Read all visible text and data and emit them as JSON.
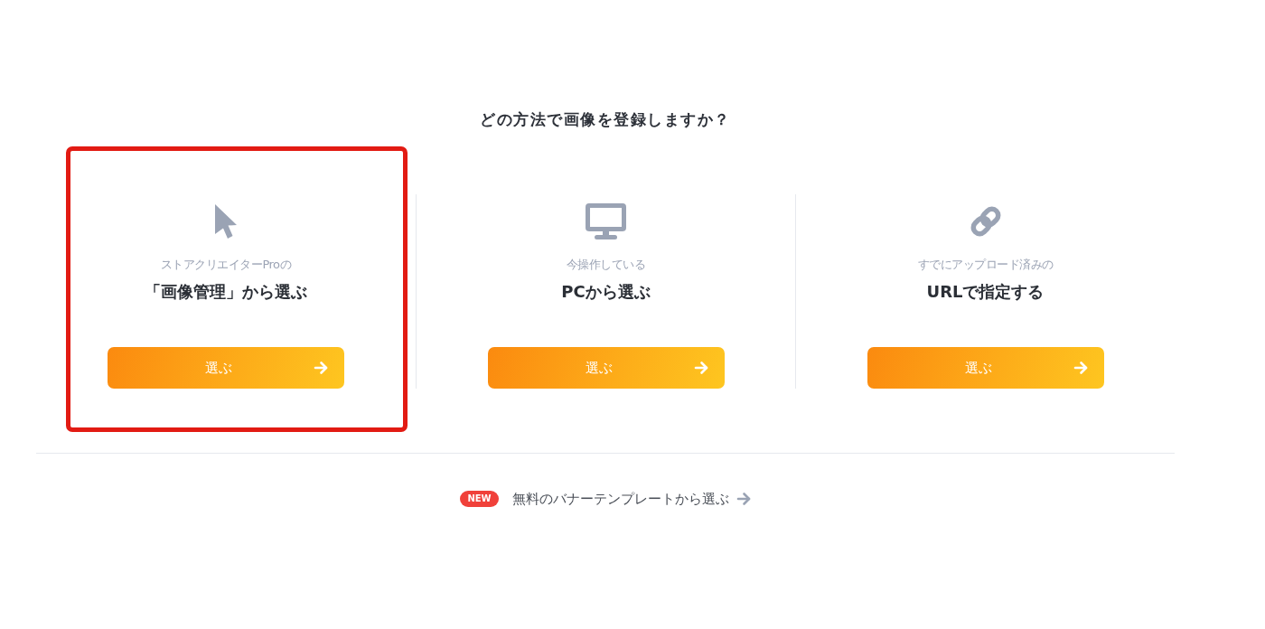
{
  "question": "どの方法で画像を登録しますか？",
  "options": [
    {
      "kind": "cursor",
      "caption": "ストアクリエイターProの",
      "title": "「画像管理」から選ぶ",
      "button": "選ぶ",
      "highlighted": true
    },
    {
      "kind": "monitor",
      "caption": "今操作している",
      "title": "PCから選ぶ",
      "button": "選ぶ",
      "highlighted": false
    },
    {
      "kind": "link",
      "caption": "すでにアップロード済みの",
      "title": "URLで指定する",
      "button": "選ぶ",
      "highlighted": false
    }
  ],
  "template_link": {
    "badge": "NEW",
    "label": "無料のバナーテンプレートから選ぶ"
  }
}
